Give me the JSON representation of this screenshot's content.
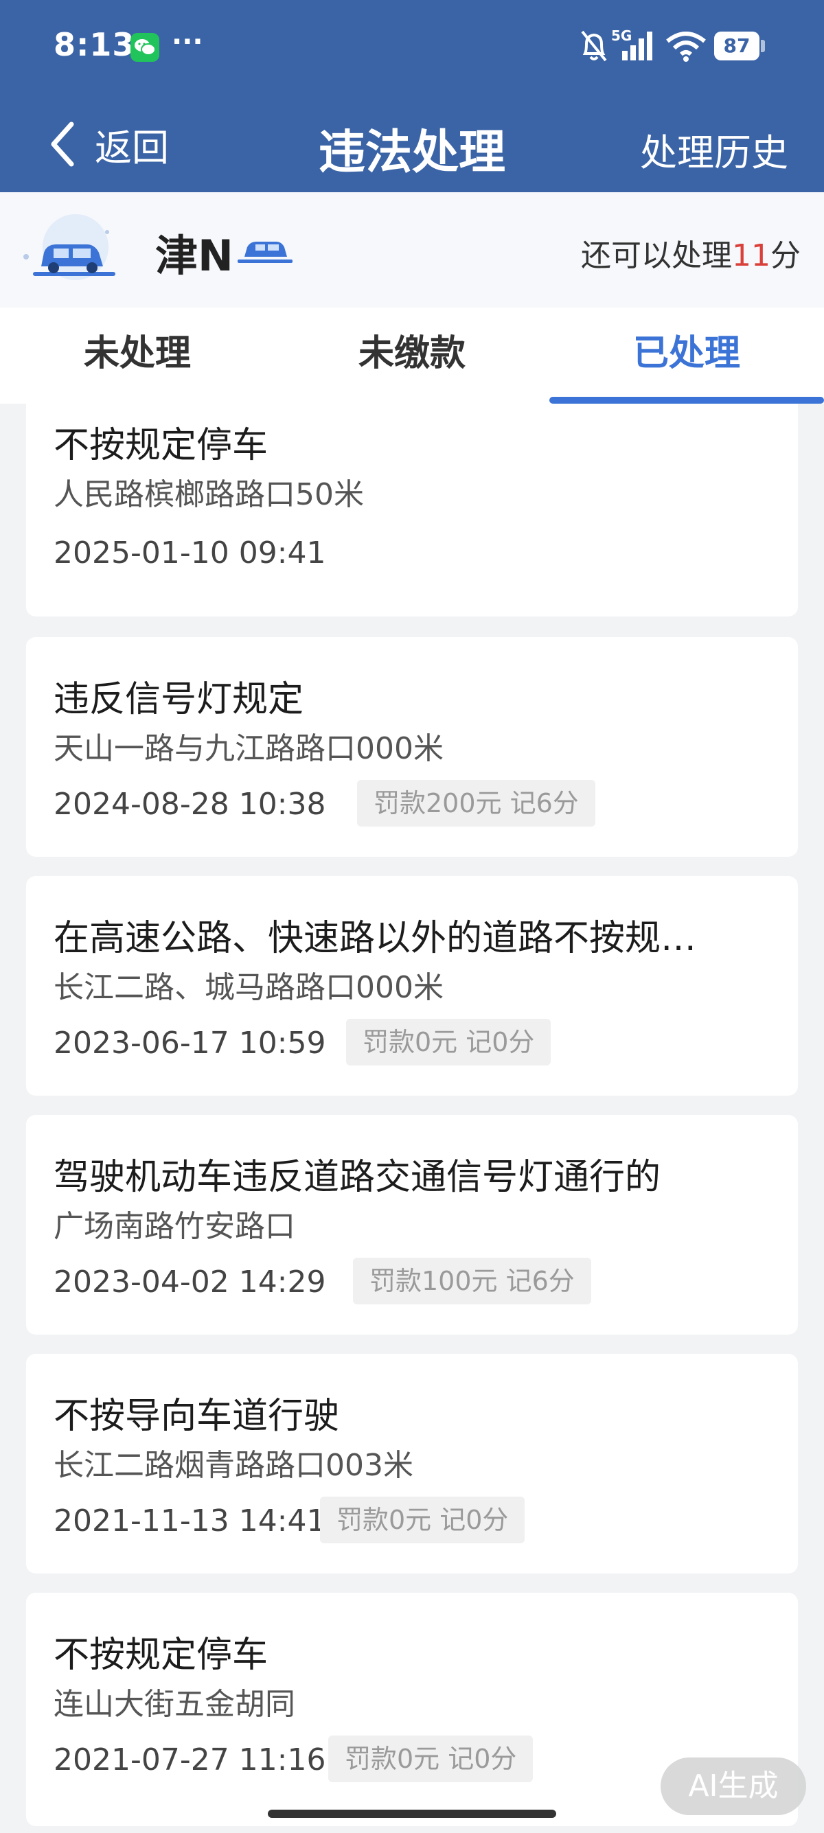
{
  "status_bar": {
    "time": "8:13",
    "more": "···",
    "network": "5G",
    "battery": "87",
    "icons": [
      "wechat-icon",
      "bell-off-icon",
      "signal-icon",
      "wifi-icon",
      "battery-icon"
    ]
  },
  "nav": {
    "back_label": "返回",
    "title": "违法处理",
    "history_label": "处理历史"
  },
  "vehicle": {
    "plate": "津N",
    "points_prefix": "还可以处理",
    "points_value": "11",
    "points_suffix": "分"
  },
  "tabs": [
    {
      "label": "未处理",
      "active": false
    },
    {
      "label": "未缴款",
      "active": false
    },
    {
      "label": "已处理",
      "active": true
    }
  ],
  "records": [
    {
      "title": "不按规定停车",
      "location": "人民路槟榔路路口50米",
      "time": "2025-01-10 09:41",
      "penalty": ""
    },
    {
      "title": "违反信号灯规定",
      "location": "天山一路与九江路路口000米",
      "time": "2024-08-28 10:38",
      "penalty": "罚款200元 记6分"
    },
    {
      "title": "在高速公路、快速路以外的道路不按规…",
      "location": "长江二路、城马路路口000米",
      "time": "2023-06-17 10:59",
      "penalty": "罚款0元 记0分"
    },
    {
      "title": "驾驶机动车违反道路交通信号灯通行的",
      "location": "广场南路竹安路口",
      "time": "2023-04-02 14:29",
      "penalty": "罚款100元 记6分"
    },
    {
      "title": "不按导向车道行驶",
      "location": "长江二路烟青路路口003米",
      "time": "2021-11-13 14:41",
      "penalty": "罚款0元 记0分"
    },
    {
      "title": "不按规定停车",
      "location": "连山大街五金胡同",
      "time": "2021-07-27 11:16",
      "penalty": "罚款0元 记0分"
    }
  ],
  "ai_badge": "AI生成",
  "colors": {
    "header": "#3b64a6",
    "accent": "#3b74d6",
    "points_highlight": "#d9403a"
  }
}
